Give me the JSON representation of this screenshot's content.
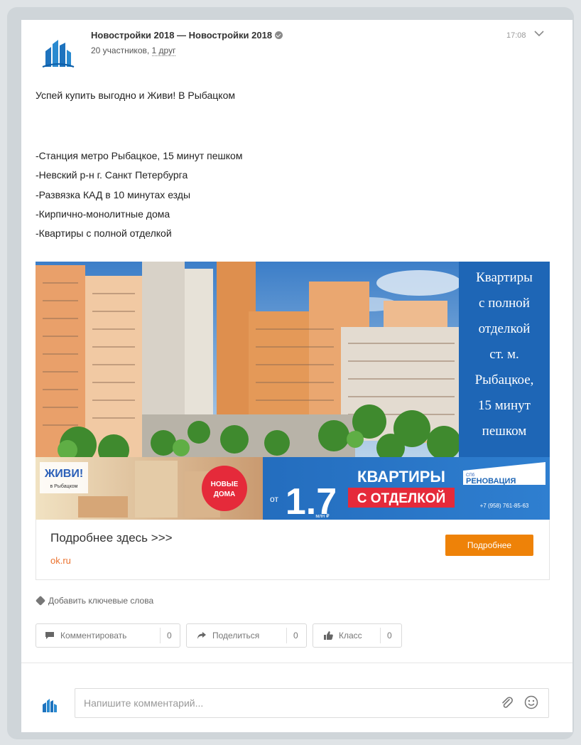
{
  "post": {
    "group_name": "Новостройки 2018 — Новостройки 2018",
    "members_prefix": "20 участников, ",
    "members_friend": "1 друг",
    "time": "17:08",
    "headline": "Успей купить выгодно и Живи! В Рыбацком",
    "bullets": [
      "-Станция метро Рыбацкое, 15 минут пешком",
      "-Невский р-н г. Санкт Петербурга",
      "-Развязка КАД в 10 минутах езды",
      "-Кирпично-монолитные дома",
      "-Квартиры с полной отделкой"
    ]
  },
  "banner": {
    "side_lines": [
      "Квартиры",
      "с полной",
      "отделкой",
      "ст. м.",
      "Рыбацкое,",
      "15 минут",
      "пешком"
    ],
    "zhivi": "ЖИВИ!",
    "zhivi_sub": "в Рыбацком",
    "badge_line1": "НОВЫЕ",
    "badge_line2": "ДОМА",
    "price_from": "от",
    "price": "1.7",
    "price_unit": "млн ₽",
    "apartments": "КВАРТИРЫ",
    "finish": "С ОТДЕЛКОЙ",
    "brand_small": "СПб",
    "brand": "РЕНОВАЦИЯ",
    "phone": "+7 (958) 761-85-63"
  },
  "link": {
    "title": "Подробнее здесь >>>",
    "domain": "ok.ru",
    "button": "Подробнее"
  },
  "keywords_label": "Добавить ключевые слова",
  "actions": {
    "comment": {
      "label": "Комментировать",
      "count": "0"
    },
    "share": {
      "label": "Поделиться",
      "count": "0"
    },
    "like": {
      "label": "Класс",
      "count": "0"
    }
  },
  "comment_placeholder": "Напишите комментарий...",
  "colors": {
    "accent": "#ee8208",
    "brand_blue": "#1e73be",
    "link_domain": "#eb722e"
  }
}
